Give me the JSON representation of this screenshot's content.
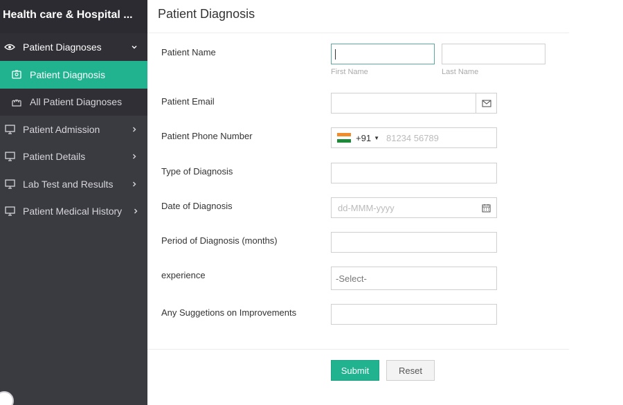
{
  "sidebar": {
    "app_title": "Health care & Hospital ...",
    "items": [
      {
        "label": "Patient Diagnoses",
        "icon": "eye-icon",
        "expanded": true
      },
      {
        "label": "Patient Diagnosis",
        "icon": "id-card-icon",
        "active": true
      },
      {
        "label": "All Patient Diagnoses",
        "icon": "hands-icon"
      },
      {
        "label": "Patient Admission",
        "icon": "monitor-icon"
      },
      {
        "label": "Patient Details",
        "icon": "monitor-icon"
      },
      {
        "label": "Lab Test and Results",
        "icon": "monitor-icon"
      },
      {
        "label": "Patient Medical History",
        "icon": "monitor-icon"
      }
    ]
  },
  "main": {
    "title": "Patient Diagnosis",
    "fields": {
      "patient_name": {
        "label": "Patient Name",
        "first_hint": "First Name",
        "last_hint": "Last Name",
        "first_value": "",
        "last_value": ""
      },
      "patient_email": {
        "label": "Patient Email",
        "value": ""
      },
      "patient_phone": {
        "label": "Patient Phone Number",
        "country_code": "+91",
        "placeholder": "81234 56789"
      },
      "type_of_diagnosis": {
        "label": "Type of Diagnosis",
        "value": ""
      },
      "date_of_diagnosis": {
        "label": "Date of Diagnosis",
        "placeholder": "dd-MMM-yyyy"
      },
      "period_of_diagnosis": {
        "label": "Period of Diagnosis (months)",
        "value": ""
      },
      "experience": {
        "label": "experience",
        "selected": "-Select-"
      },
      "suggestions": {
        "label": "Any Suggetions on Improvements",
        "value": ""
      }
    },
    "buttons": {
      "submit": "Submit",
      "reset": "Reset"
    }
  },
  "colors": {
    "accent": "#21b38f",
    "sidebar_bg": "#3a3a41",
    "sidebar_header_bg": "#2b2b31"
  }
}
